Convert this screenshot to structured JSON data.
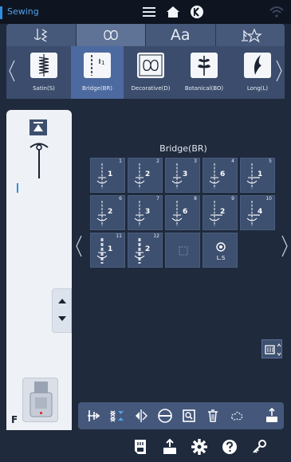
{
  "status_bar": {
    "title": "Sewing"
  },
  "category_tabs": [
    {
      "icon": "utility-stitch-icon",
      "active": false
    },
    {
      "icon": "decorative-stitch-icon",
      "active": true
    },
    {
      "icon": "character-icon",
      "label": "Aa",
      "active": false
    },
    {
      "icon": "favorite-stitch-icon",
      "active": false
    }
  ],
  "subcategories": [
    {
      "label": "Satin(S)",
      "active": false
    },
    {
      "label": "Bridge(BR)",
      "active": true
    },
    {
      "label": "Decorative(D)",
      "active": false
    },
    {
      "label": "Botanical(BO)",
      "active": false
    },
    {
      "label": "Long(L)",
      "active": false
    }
  ],
  "left_panel": {
    "foot_letter": "F"
  },
  "stitch_panel": {
    "title": "Bridge(BR)",
    "cells": [
      {
        "number": "1",
        "glyph": "1"
      },
      {
        "number": "2",
        "glyph": "2"
      },
      {
        "number": "3",
        "glyph": "3"
      },
      {
        "number": "4",
        "glyph": "6"
      },
      {
        "number": "5",
        "glyph": "1"
      },
      {
        "number": "6",
        "glyph": "2"
      },
      {
        "number": "7",
        "glyph": "3"
      },
      {
        "number": "8",
        "glyph": "6"
      },
      {
        "number": "9",
        "glyph": "2"
      },
      {
        "number": "10",
        "glyph": "4"
      },
      {
        "number": "11",
        "glyph": "1"
      },
      {
        "number": "12",
        "glyph": "2"
      },
      {
        "number": "",
        "glyph": ""
      },
      {
        "number": "",
        "glyph": "L.S"
      }
    ]
  },
  "toolbar_icons": [
    "mirror-horizontal-icon",
    "mirror-vertical-icon",
    "pattern-flip-icon",
    "thread-tension-icon",
    "zoom-icon",
    "delete-icon",
    "stitch-preview-icon",
    "export-icon"
  ],
  "bottom_icons": [
    "memory-icon",
    "upload-icon",
    "settings-icon",
    "help-icon",
    "key-icon"
  ],
  "colors": {
    "accent": "#2f8fe0",
    "panel": "#3b4c6c",
    "cell": "#3e5070",
    "background": "#1f2a3c"
  }
}
